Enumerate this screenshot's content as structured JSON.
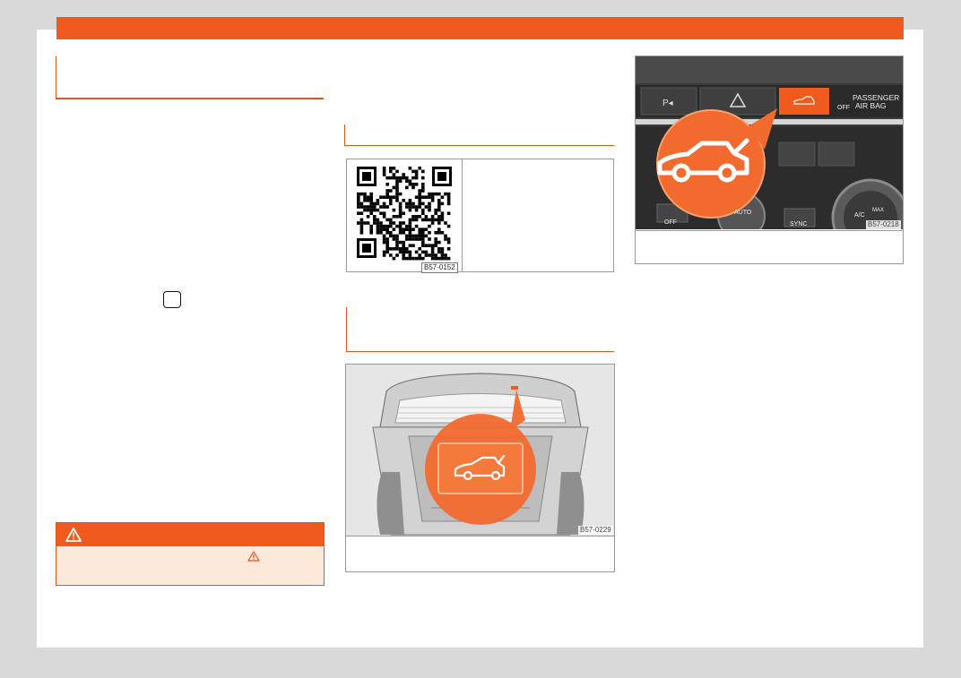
{
  "colors": {
    "accent": "#f05a1c",
    "warning_bg": "#fde9da",
    "page_bg": "#ffffff",
    "margin_bg": "#d9d9d9"
  },
  "left_column": {
    "key_symbol_icon": "rounded-square-key-icon",
    "warning_box": {
      "icon": "warning-triangle-icon",
      "reference_icon": "warning-triangle-icon"
    }
  },
  "middle_column": {
    "qr_figure": {
      "image_code": "B57-0152",
      "icon": "qr-code-icon"
    },
    "trunk_figure": {
      "image_code": "B57-0229",
      "icon": "tailgate-open-car-icon"
    }
  },
  "right_column": {
    "dashboard_figure": {
      "image_code": "B57-0218",
      "passenger_airbag_line1": "PASSENGER",
      "passenger_airbag_line2": "AIR BAG",
      "airbag_off_label": "OFF",
      "button_off_label": "OFF",
      "button_auto_label": "AUTO",
      "button_sync_label": "SYNC",
      "button_ac_label": "A/C",
      "button_max_label": "MAX",
      "icon": "tailgate-open-car-icon"
    }
  }
}
